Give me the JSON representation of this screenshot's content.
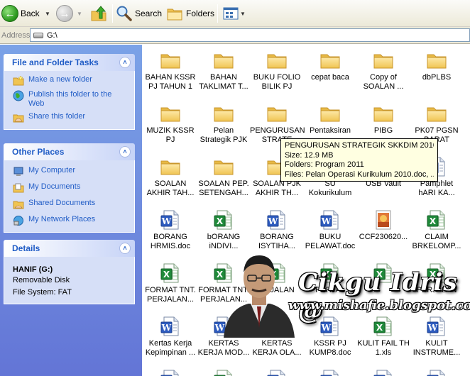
{
  "toolbar": {
    "back_label": "Back",
    "search_label": "Search",
    "folders_label": "Folders"
  },
  "address": {
    "label": "Address",
    "value": "G:\\"
  },
  "tasks_panel": {
    "title": "File and Folder Tasks",
    "items": [
      {
        "label": "Make a new folder",
        "icon": "new-folder-icon"
      },
      {
        "label": "Publish this folder to the Web",
        "icon": "publish-web-icon"
      },
      {
        "label": "Share this folder",
        "icon": "share-folder-icon"
      }
    ]
  },
  "places_panel": {
    "title": "Other Places",
    "items": [
      {
        "label": "My Computer",
        "icon": "my-computer-icon"
      },
      {
        "label": "My Documents",
        "icon": "my-documents-icon"
      },
      {
        "label": "Shared Documents",
        "icon": "shared-documents-icon"
      },
      {
        "label": "My Network Places",
        "icon": "network-places-icon"
      }
    ]
  },
  "details_panel": {
    "title": "Details",
    "name": "HANIF (G:)",
    "type": "Removable Disk",
    "filesystem": "File System: FAT"
  },
  "files": [
    {
      "label": "BAHAN KSSR\nPJ TAHUN 1",
      "type": "folder"
    },
    {
      "label": "BAHAN\nTAKLIMAT T...",
      "type": "folder"
    },
    {
      "label": "BUKU FOLIO\nBILIK PJ",
      "type": "folder"
    },
    {
      "label": "cepat baca",
      "type": "folder"
    },
    {
      "label": "Copy of\nSOALAN ...",
      "type": "folder"
    },
    {
      "label": "dbPLBS",
      "type": "folder"
    },
    {
      "label": "MUZIK KSSR\nPJ",
      "type": "folder"
    },
    {
      "label": "Pelan\nStrategik PJK",
      "type": "folder"
    },
    {
      "label": "PENGURUSAN\nSTRATE",
      "type": "folder"
    },
    {
      "label": "Pentaksiran",
      "type": "folder"
    },
    {
      "label": "PIBG",
      "type": "folder"
    },
    {
      "label": "PK07 PGSN\nBARAT",
      "type": "folder"
    },
    {
      "label": "SOALAN\nAKHIR TAH...",
      "type": "folder"
    },
    {
      "label": "SOALAN PEP.\nSETENGAH...",
      "type": "folder"
    },
    {
      "label": "SOALAN PJK\nAKHIR TH...",
      "type": "folder"
    },
    {
      "label": "SU\nKokurikulum",
      "type": "folder"
    },
    {
      "label": "USB Vault",
      "type": "folder"
    },
    {
      "label": "Pamphlet\nhARI KA...",
      "type": "doc"
    },
    {
      "label": "BORANG\nHRMIS.doc",
      "type": "doc"
    },
    {
      "label": "bORANG\niNDIVI...",
      "type": "xls"
    },
    {
      "label": "BORANG\nISYTIHA...",
      "type": "doc"
    },
    {
      "label": "BUKU\nPELAWAT.doc",
      "type": "doc"
    },
    {
      "label": "CCF230620...",
      "type": "img"
    },
    {
      "label": "CLAIM\nBRKELOMP...",
      "type": "xls"
    },
    {
      "label": "FORMAT TNT.\nPERJALAN...",
      "type": "xls"
    },
    {
      "label": "FORMAT TNT.\nPERJALAN...",
      "type": "xls"
    },
    {
      "label": "ERJALAN",
      "type": "xls"
    },
    {
      "label": "PERJAL",
      "type": "xls"
    },
    {
      "label": "",
      "type": "xls"
    },
    {
      "label": "PERJALAN",
      "type": "xls"
    },
    {
      "label": "Kertas Kerja\nKepimpinan ...",
      "type": "doc"
    },
    {
      "label": "KERTAS\nKERJA MOD...",
      "type": "doc"
    },
    {
      "label": "KERTAS\nKERJA OLA...",
      "type": "doc"
    },
    {
      "label": "KSSR PJ\nKUMP8.doc",
      "type": "doc"
    },
    {
      "label": "KULIT FAIL TH\n1.xls",
      "type": "xls"
    },
    {
      "label": "KULIT\nINSTRUME...",
      "type": "doc"
    },
    {
      "label": "",
      "type": "doc"
    },
    {
      "label": "",
      "type": "xls"
    },
    {
      "label": "",
      "type": "doc"
    },
    {
      "label": "",
      "type": "doc"
    },
    {
      "label": "",
      "type": "doc"
    },
    {
      "label": "",
      "type": "doc"
    }
  ],
  "tooltip": {
    "line1": "PENGURUSAN STRATEGIK SKKDIM 2010",
    "line2": "Size: 12.9 MB",
    "line3": "Folders: Program 2011",
    "line4": "Files: Pelan Operasi Kurikulum 2010.doc, ..."
  },
  "watermark": {
    "title": "Cikgu Idris @",
    "url": "www.mishafie.blogspot.com"
  },
  "colors": {
    "task_pane_top": "#7ba2e7",
    "task_pane_bottom": "#6375d6",
    "link_blue": "#215dc6",
    "tooltip_bg": "#ffffe1",
    "folder_yellow": "#f8d775"
  }
}
